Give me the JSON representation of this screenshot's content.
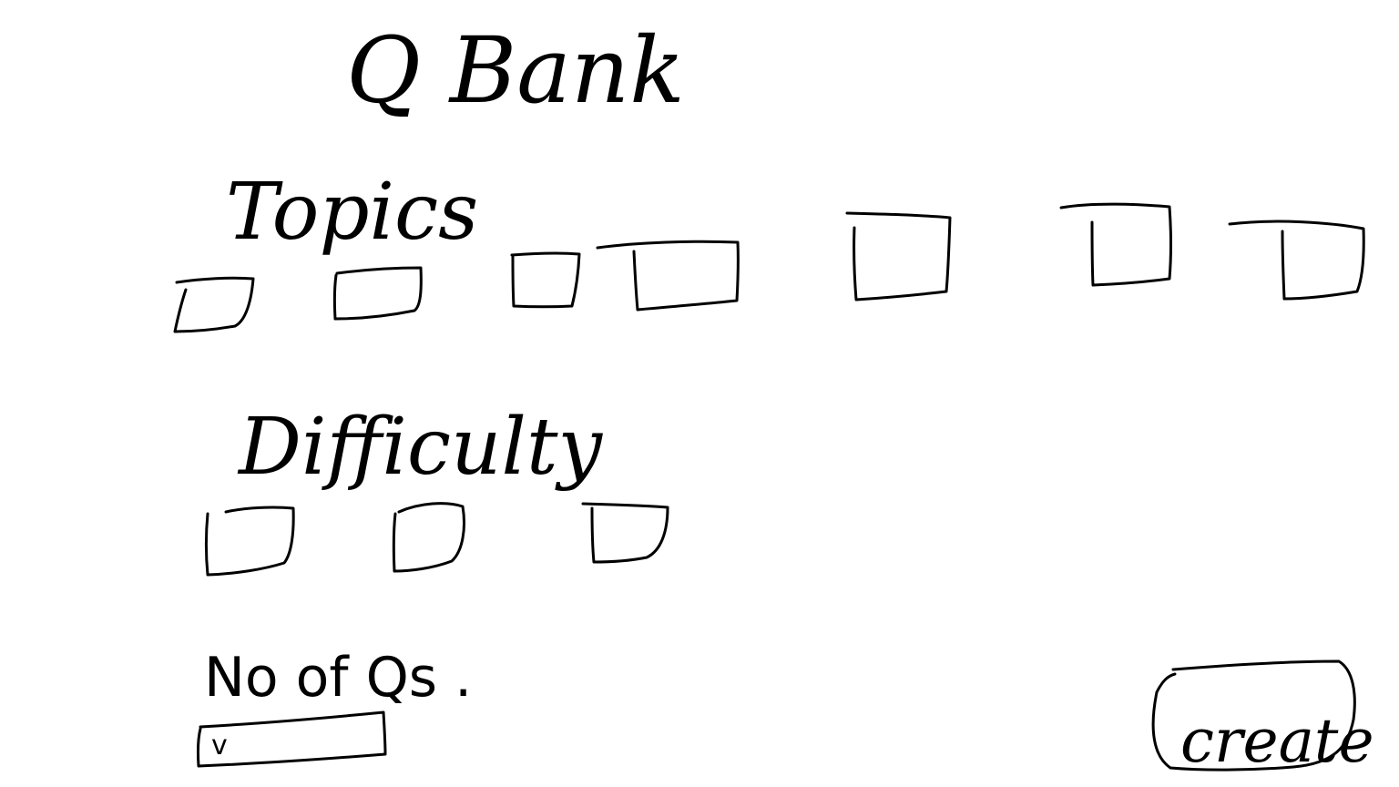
{
  "header": {
    "title": "Q Bank"
  },
  "topics": {
    "label": "Topics",
    "checkboxes": [
      {
        "checked": false
      },
      {
        "checked": false
      },
      {
        "checked": false
      },
      {
        "checked": false
      },
      {
        "checked": false
      },
      {
        "checked": false
      },
      {
        "checked": false
      }
    ]
  },
  "difficulty": {
    "label": "Difficulty",
    "checkboxes": [
      {
        "checked": false
      },
      {
        "checked": false
      },
      {
        "checked": false
      }
    ]
  },
  "question_count": {
    "label": "No of Qs .",
    "input_value": "v"
  },
  "actions": {
    "create_label": "create"
  }
}
